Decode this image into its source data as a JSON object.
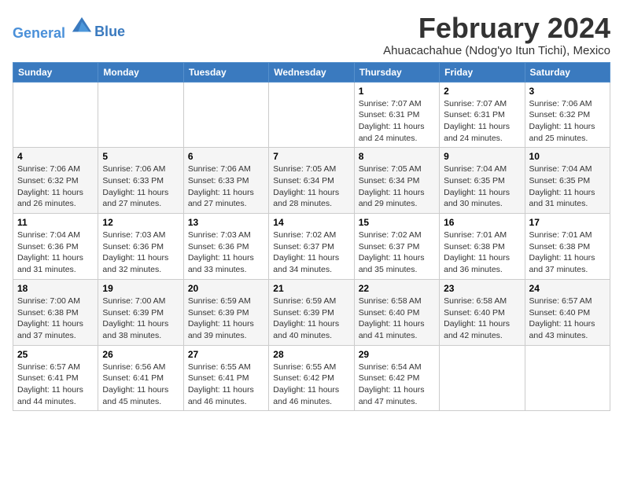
{
  "logo": {
    "line1": "General",
    "line2": "Blue"
  },
  "title": "February 2024",
  "location": "Ahuacachahue (Ndog'yo Itun Tichi), Mexico",
  "days_of_week": [
    "Sunday",
    "Monday",
    "Tuesday",
    "Wednesday",
    "Thursday",
    "Friday",
    "Saturday"
  ],
  "weeks": [
    [
      {
        "day": "",
        "info": ""
      },
      {
        "day": "",
        "info": ""
      },
      {
        "day": "",
        "info": ""
      },
      {
        "day": "",
        "info": ""
      },
      {
        "day": "1",
        "info": "Sunrise: 7:07 AM\nSunset: 6:31 PM\nDaylight: 11 hours and 24 minutes."
      },
      {
        "day": "2",
        "info": "Sunrise: 7:07 AM\nSunset: 6:31 PM\nDaylight: 11 hours and 24 minutes."
      },
      {
        "day": "3",
        "info": "Sunrise: 7:06 AM\nSunset: 6:32 PM\nDaylight: 11 hours and 25 minutes."
      }
    ],
    [
      {
        "day": "4",
        "info": "Sunrise: 7:06 AM\nSunset: 6:32 PM\nDaylight: 11 hours and 26 minutes."
      },
      {
        "day": "5",
        "info": "Sunrise: 7:06 AM\nSunset: 6:33 PM\nDaylight: 11 hours and 27 minutes."
      },
      {
        "day": "6",
        "info": "Sunrise: 7:06 AM\nSunset: 6:33 PM\nDaylight: 11 hours and 27 minutes."
      },
      {
        "day": "7",
        "info": "Sunrise: 7:05 AM\nSunset: 6:34 PM\nDaylight: 11 hours and 28 minutes."
      },
      {
        "day": "8",
        "info": "Sunrise: 7:05 AM\nSunset: 6:34 PM\nDaylight: 11 hours and 29 minutes."
      },
      {
        "day": "9",
        "info": "Sunrise: 7:04 AM\nSunset: 6:35 PM\nDaylight: 11 hours and 30 minutes."
      },
      {
        "day": "10",
        "info": "Sunrise: 7:04 AM\nSunset: 6:35 PM\nDaylight: 11 hours and 31 minutes."
      }
    ],
    [
      {
        "day": "11",
        "info": "Sunrise: 7:04 AM\nSunset: 6:36 PM\nDaylight: 11 hours and 31 minutes."
      },
      {
        "day": "12",
        "info": "Sunrise: 7:03 AM\nSunset: 6:36 PM\nDaylight: 11 hours and 32 minutes."
      },
      {
        "day": "13",
        "info": "Sunrise: 7:03 AM\nSunset: 6:36 PM\nDaylight: 11 hours and 33 minutes."
      },
      {
        "day": "14",
        "info": "Sunrise: 7:02 AM\nSunset: 6:37 PM\nDaylight: 11 hours and 34 minutes."
      },
      {
        "day": "15",
        "info": "Sunrise: 7:02 AM\nSunset: 6:37 PM\nDaylight: 11 hours and 35 minutes."
      },
      {
        "day": "16",
        "info": "Sunrise: 7:01 AM\nSunset: 6:38 PM\nDaylight: 11 hours and 36 minutes."
      },
      {
        "day": "17",
        "info": "Sunrise: 7:01 AM\nSunset: 6:38 PM\nDaylight: 11 hours and 37 minutes."
      }
    ],
    [
      {
        "day": "18",
        "info": "Sunrise: 7:00 AM\nSunset: 6:38 PM\nDaylight: 11 hours and 37 minutes."
      },
      {
        "day": "19",
        "info": "Sunrise: 7:00 AM\nSunset: 6:39 PM\nDaylight: 11 hours and 38 minutes."
      },
      {
        "day": "20",
        "info": "Sunrise: 6:59 AM\nSunset: 6:39 PM\nDaylight: 11 hours and 39 minutes."
      },
      {
        "day": "21",
        "info": "Sunrise: 6:59 AM\nSunset: 6:39 PM\nDaylight: 11 hours and 40 minutes."
      },
      {
        "day": "22",
        "info": "Sunrise: 6:58 AM\nSunset: 6:40 PM\nDaylight: 11 hours and 41 minutes."
      },
      {
        "day": "23",
        "info": "Sunrise: 6:58 AM\nSunset: 6:40 PM\nDaylight: 11 hours and 42 minutes."
      },
      {
        "day": "24",
        "info": "Sunrise: 6:57 AM\nSunset: 6:40 PM\nDaylight: 11 hours and 43 minutes."
      }
    ],
    [
      {
        "day": "25",
        "info": "Sunrise: 6:57 AM\nSunset: 6:41 PM\nDaylight: 11 hours and 44 minutes."
      },
      {
        "day": "26",
        "info": "Sunrise: 6:56 AM\nSunset: 6:41 PM\nDaylight: 11 hours and 45 minutes."
      },
      {
        "day": "27",
        "info": "Sunrise: 6:55 AM\nSunset: 6:41 PM\nDaylight: 11 hours and 46 minutes."
      },
      {
        "day": "28",
        "info": "Sunrise: 6:55 AM\nSunset: 6:42 PM\nDaylight: 11 hours and 46 minutes."
      },
      {
        "day": "29",
        "info": "Sunrise: 6:54 AM\nSunset: 6:42 PM\nDaylight: 11 hours and 47 minutes."
      },
      {
        "day": "",
        "info": ""
      },
      {
        "day": "",
        "info": ""
      }
    ]
  ]
}
